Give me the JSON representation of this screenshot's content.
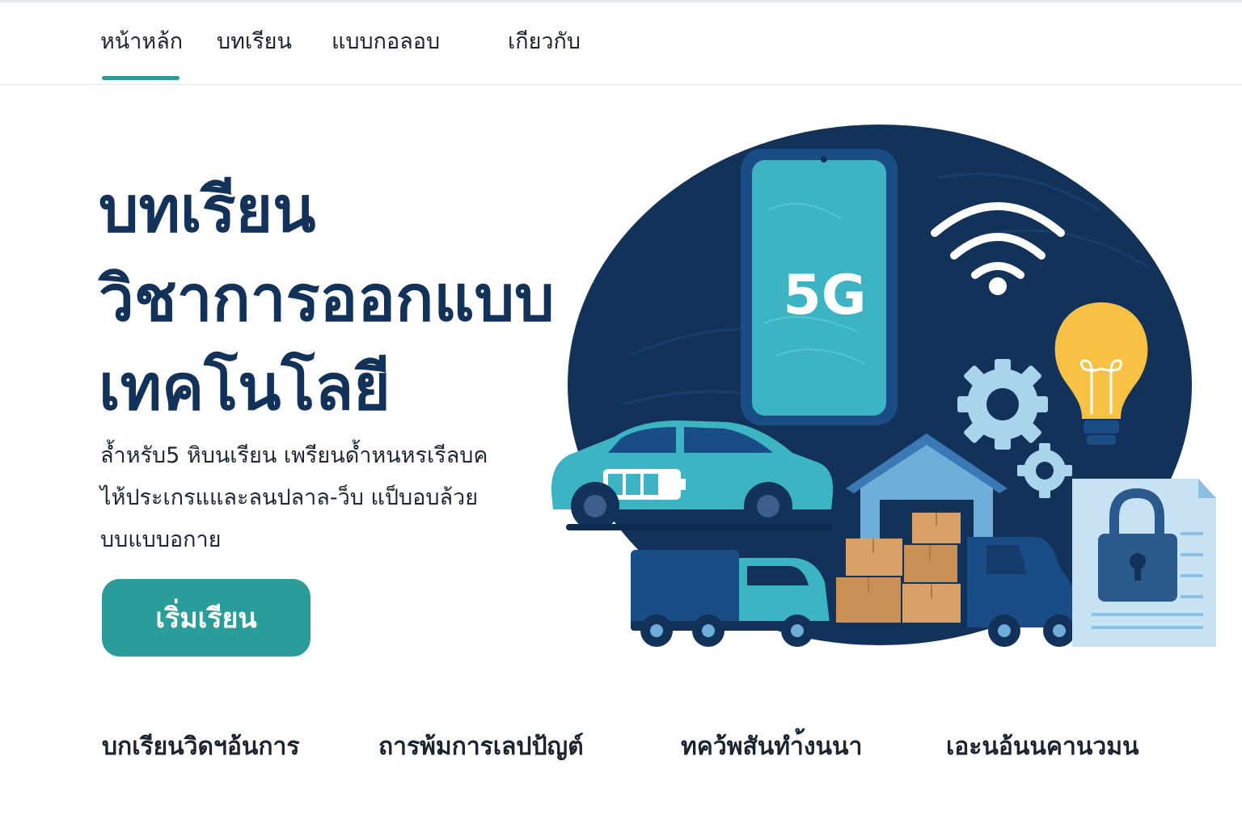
{
  "nav": {
    "items": [
      {
        "label": "หน้าหล้ก"
      },
      {
        "label": "บทเรียน"
      },
      {
        "label": "แบบกอลอบ"
      },
      {
        "label": "เกียวกับ"
      }
    ],
    "active_index": 0
  },
  "hero": {
    "title_lines": [
      "บทเรียน",
      "วิชาการออกแบบ",
      "เทคโนโลยี"
    ],
    "description_lines": [
      "ล้ำหรับ5 หิบนเรียน เพรียนด้ำหนหรเรีลบค",
      "ไห้ประเกรแและลนปลาล-ว็บ แป็บอบล้วย",
      "บบแบบอกาย"
    ],
    "cta_label": "เริ่มเรียน"
  },
  "illustration": {
    "phone_label": "5G",
    "elements": [
      "smartphone-5g",
      "wifi-icon",
      "lightbulb-icon",
      "gear-icon",
      "electric-car",
      "warehouse",
      "boxes",
      "delivery-truck",
      "van",
      "document-lock-icon"
    ]
  },
  "features": [
    {
      "label": "บกเรียนวิดฯอ้นการ"
    },
    {
      "label": "ถารพ้มการเลปป้ญต์"
    },
    {
      "label": "ทคว้พสันทำ้งนนา"
    },
    {
      "label": "เอะนอ้นนคานวมน"
    }
  ],
  "colors": {
    "primary": "#12325a",
    "accent": "#2a9d9b",
    "circle": "#12325a",
    "teal_light": "#3cb4c4",
    "bulb": "#f7c244",
    "box": "#d9a067"
  }
}
